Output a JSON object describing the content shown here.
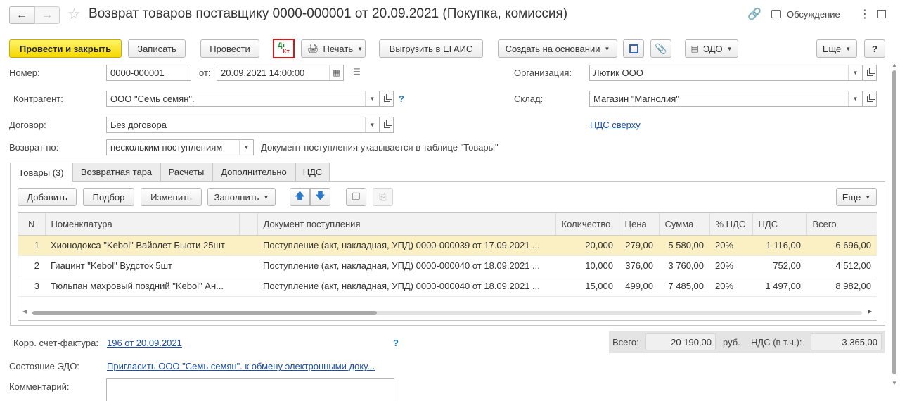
{
  "window": {
    "title": "Возврат товаров поставщику 0000-000001 от 20.09.2021 (Покупка, комиссия)",
    "discussion_label": "Обсуждение"
  },
  "toolbar": {
    "post_close": "Провести и закрыть",
    "save": "Записать",
    "post": "Провести",
    "dtkt_top": "Дт",
    "dtkt_bottom": "Кт",
    "print": "Печать",
    "egais": "Выгрузить в ЕГАИС",
    "create_based": "Создать на основании",
    "edo": "ЭДО",
    "more": "Еще",
    "help": "?"
  },
  "form": {
    "number_label": "Номер:",
    "number_value": "0000-000001",
    "from_label": "от:",
    "date_value": "20.09.2021 14:00:00",
    "org_label": "Организация:",
    "org_value": "Лютик ООО",
    "contractor_label": "Контрагент:",
    "contractor_value": "ООО \"Семь семян\".",
    "contractor_help": "?",
    "warehouse_label": "Склад:",
    "warehouse_value": "Магазин \"Магнолия\"",
    "contract_label": "Договор:",
    "contract_value": "Без договора",
    "vat_link": "НДС сверху",
    "return_label": "Возврат по:",
    "return_value": "нескольким поступлениям",
    "return_hint": "Документ поступления указывается в таблице \"Товары\""
  },
  "tabs": [
    {
      "label": "Товары (3)"
    },
    {
      "label": "Возвратная тара"
    },
    {
      "label": "Расчеты"
    },
    {
      "label": "Дополнительно"
    },
    {
      "label": "НДС"
    }
  ],
  "table_toolbar": {
    "add": "Добавить",
    "pick": "Подбор",
    "edit": "Изменить",
    "fill": "Заполнить",
    "more": "Еще"
  },
  "table": {
    "columns": [
      "N",
      "Номенклатура",
      "Документ поступления",
      "Количество",
      "Цена",
      "Сумма",
      "% НДС",
      "НДС",
      "Всего"
    ],
    "rows": [
      {
        "n": "1",
        "item": "Хионодокса \"Kebol\" Вайолет Бьюти 25шт",
        "doc": "Поступление (акт, накладная, УПД) 0000-000039 от 17.09.2021 ...",
        "qty": "20,000",
        "price": "279,00",
        "sum": "5 580,00",
        "vat_rate": "20%",
        "vat": "1 116,00",
        "total": "6 696,00"
      },
      {
        "n": "2",
        "item": "Гиацинт \"Kebol\" Вудсток 5шт",
        "doc": "Поступление (акт, накладная, УПД) 0000-000040 от 18.09.2021 ...",
        "qty": "10,000",
        "price": "376,00",
        "sum": "3 760,00",
        "vat_rate": "20%",
        "vat": "752,00",
        "total": "4 512,00"
      },
      {
        "n": "3",
        "item": "Тюльпан махровый поздний \"Kebol\" Ан...",
        "doc": "Поступление (акт, накладная, УПД) 0000-000040 от 18.09.2021 ...",
        "qty": "15,000",
        "price": "499,00",
        "sum": "7 485,00",
        "vat_rate": "20%",
        "vat": "1 497,00",
        "total": "8 982,00"
      }
    ]
  },
  "footer": {
    "invoice_label": "Корр. счет-фактура:",
    "invoice_link": "196 от 20.09.2021",
    "invoice_help": "?",
    "edo_label": "Состояние ЭДО:",
    "edo_link": "Пригласить ООО \"Семь семян\". к обмену электронными доку...",
    "comment_label": "Комментарий:",
    "total_label": "Всего:",
    "total_value": "20 190,00",
    "currency": "руб.",
    "vat_label": "НДС (в т.ч.):",
    "vat_value": "3 365,00"
  }
}
